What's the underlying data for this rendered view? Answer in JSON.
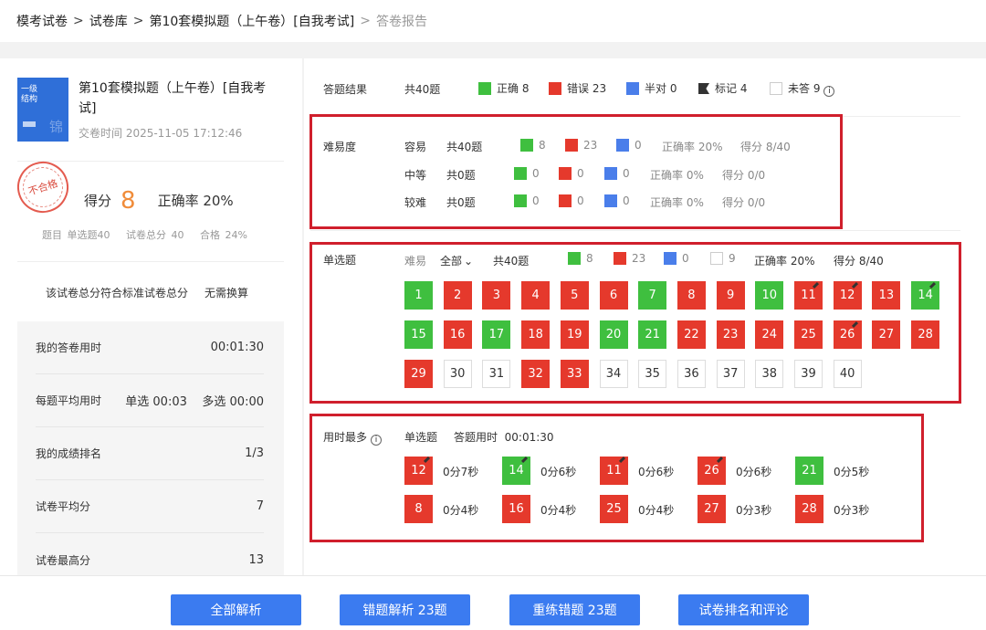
{
  "breadcrumb": [
    "模考试卷",
    "试卷库",
    "第10套模拟题（上午卷）[自我考试]",
    "答卷报告"
  ],
  "paper": {
    "cover_line1": "一级",
    "cover_line2": "结构",
    "cover_big": "锦",
    "title": "第10套模拟题（上午卷）[自我考试]",
    "submit_time": "交卷时间 2025-11-05 17:12:46"
  },
  "result": {
    "stamp": "不合格",
    "score_label": "得分",
    "score": "8",
    "accuracy": "正确率 20%",
    "meta": [
      "题目 单选题40",
      "试卷总分 40",
      "合格 24%"
    ],
    "note": "该试卷总分符合标准试卷总分",
    "note_extra": "无需换算"
  },
  "stats": [
    {
      "label": "我的答卷用时",
      "value": "00:01:30"
    },
    {
      "label": "每题平均用时",
      "value": "单选 00:03    多选 00:00"
    },
    {
      "label": "我的成绩排名",
      "value": "1/3"
    },
    {
      "label": "试卷平均分",
      "value": "7"
    },
    {
      "label": "试卷最高分",
      "value": "13"
    }
  ],
  "summary": {
    "label": "答题结果",
    "total": "共40题",
    "correct": "正确 8",
    "wrong": "错误 23",
    "half": "半对 0",
    "marked": "标记 4",
    "unanswered": "未答 9"
  },
  "difficulty": {
    "label": "难易度",
    "rows": [
      {
        "level": "容易",
        "total": "共40题",
        "g": "8",
        "r": "23",
        "b": "0",
        "acc": "正确率 20%",
        "score": "得分 8/40"
      },
      {
        "level": "中等",
        "total": "共0题",
        "g": "0",
        "r": "0",
        "b": "0",
        "acc": "正确率 0%",
        "score": "得分 0/0"
      },
      {
        "level": "较难",
        "total": "共0题",
        "g": "0",
        "r": "0",
        "b": "0",
        "acc": "正确率 0%",
        "score": "得分 0/0"
      }
    ]
  },
  "single": {
    "label": "单选题",
    "diff_label": "难易",
    "diff_value": "全部",
    "total": "共40题",
    "g": "8",
    "r": "23",
    "b": "0",
    "w": "9",
    "acc": "正确率 20%",
    "score": "得分 8/40",
    "cells": [
      {
        "n": "1",
        "s": "g"
      },
      {
        "n": "2",
        "s": "r"
      },
      {
        "n": "3",
        "s": "r"
      },
      {
        "n": "4",
        "s": "r"
      },
      {
        "n": "5",
        "s": "r"
      },
      {
        "n": "6",
        "s": "r"
      },
      {
        "n": "7",
        "s": "g"
      },
      {
        "n": "8",
        "s": "r"
      },
      {
        "n": "9",
        "s": "r"
      },
      {
        "n": "10",
        "s": "g"
      },
      {
        "n": "11",
        "s": "r",
        "p": 1
      },
      {
        "n": "12",
        "s": "r",
        "p": 1
      },
      {
        "n": "13",
        "s": "r"
      },
      {
        "n": "14",
        "s": "g",
        "p": 1
      },
      {
        "n": "15",
        "s": "g"
      },
      {
        "n": "16",
        "s": "r"
      },
      {
        "n": "17",
        "s": "g"
      },
      {
        "n": "18",
        "s": "r"
      },
      {
        "n": "19",
        "s": "r"
      },
      {
        "n": "20",
        "s": "g"
      },
      {
        "n": "21",
        "s": "g"
      },
      {
        "n": "22",
        "s": "r"
      },
      {
        "n": "23",
        "s": "r"
      },
      {
        "n": "24",
        "s": "r"
      },
      {
        "n": "25",
        "s": "r"
      },
      {
        "n": "26",
        "s": "r",
        "p": 1
      },
      {
        "n": "27",
        "s": "r"
      },
      {
        "n": "28",
        "s": "r"
      },
      {
        "n": "29",
        "s": "r"
      },
      {
        "n": "30",
        "s": "w"
      },
      {
        "n": "31",
        "s": "w"
      },
      {
        "n": "32",
        "s": "r"
      },
      {
        "n": "33",
        "s": "r"
      },
      {
        "n": "34",
        "s": "w"
      },
      {
        "n": "35",
        "s": "w"
      },
      {
        "n": "36",
        "s": "w"
      },
      {
        "n": "37",
        "s": "w"
      },
      {
        "n": "38",
        "s": "w"
      },
      {
        "n": "39",
        "s": "w"
      },
      {
        "n": "40",
        "s": "w"
      }
    ]
  },
  "time_most": {
    "label": "用时最多",
    "type": "单选题",
    "time": "答题用时  00:01:30",
    "items": [
      {
        "n": "12",
        "s": "r",
        "p": 1,
        "t": "0分7秒"
      },
      {
        "n": "14",
        "s": "g",
        "p": 1,
        "t": "0分6秒"
      },
      {
        "n": "11",
        "s": "r",
        "p": 1,
        "t": "0分6秒"
      },
      {
        "n": "26",
        "s": "r",
        "p": 1,
        "t": "0分6秒"
      },
      {
        "n": "21",
        "s": "g",
        "t": "0分5秒"
      },
      {
        "n": "8",
        "s": "r",
        "t": "0分4秒"
      },
      {
        "n": "16",
        "s": "r",
        "t": "0分4秒"
      },
      {
        "n": "25",
        "s": "r",
        "t": "0分4秒"
      },
      {
        "n": "27",
        "s": "r",
        "t": "0分3秒"
      },
      {
        "n": "28",
        "s": "r",
        "t": "0分3秒"
      }
    ]
  },
  "buttons": [
    "全部解析",
    "错题解析 23题",
    "重练错题 23题",
    "试卷排名和评论"
  ],
  "colors": {
    "correct": "#3fbf3f",
    "wrong": "#e5392c",
    "half": "#4a7eea",
    "primary": "#3b7bf0",
    "highlight": "#d01f2c"
  }
}
